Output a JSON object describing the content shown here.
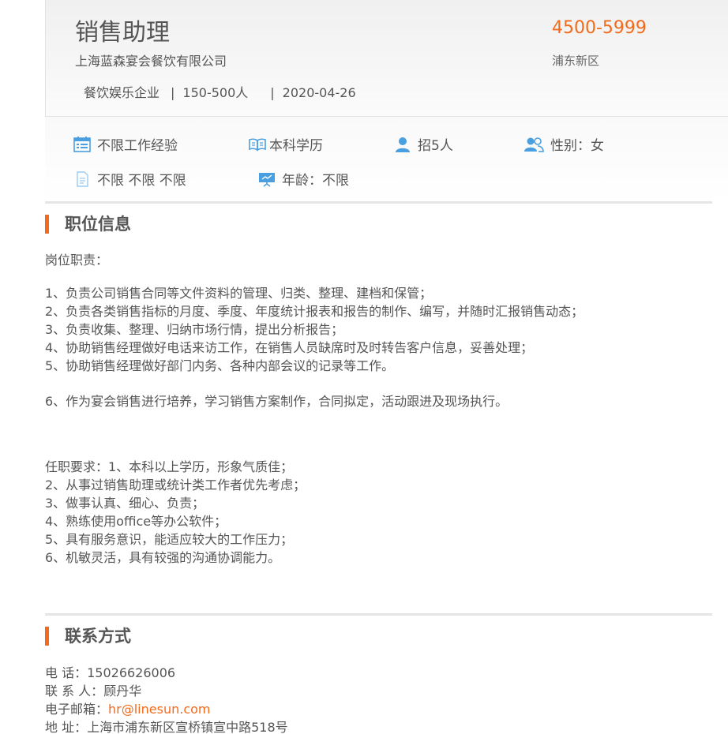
{
  "job": {
    "title": "销售助理",
    "company": "上海蓝森宴会餐饮有限公司",
    "industry": "餐饮娱乐企业",
    "size": "150-500人",
    "date": "2020-04-26",
    "separator": "|",
    "salary": "4500-5999",
    "location": "浦东新区"
  },
  "tags": {
    "experience": "不限工作经验",
    "education": "本科学历",
    "headcount": "招5人",
    "gender": "性别：女",
    "other": "不限 不限 不限",
    "age": "年龄：不限"
  },
  "position_info": {
    "title": "职位信息",
    "duties_label": "岗位职责：",
    "duties": [
      "1、负责公司销售合同等文件资料的管理、归类、整理、建档和保管；",
      "2、负责各类销售指标的月度、季度、年度统计报表和报告的制作、编写，并随时汇报销售动态；",
      "3、负责收集、整理、归纳市场行情，提出分析报告；",
      "4、协助销售经理做好电话来访工作，在销售人员缺席时及时转告客户信息，妥善处理；",
      "5、协助销售经理做好部门内务、各种内部会议的记录等工作。"
    ],
    "duty_6": "6、作为宴会销售进行培养，学习销售方案制作，合同拟定，活动跟进及现场执行。",
    "requirements": [
      "任职要求：1、本科以上学历，形象气质佳；",
      "2、从事过销售助理或统计类工作者优先考虑；",
      "3、做事认真、细心、负责；",
      "4、熟练使用office等办公软件；",
      "5、具有服务意识，能适应较大的工作压力；",
      "6、机敏灵活，具有较强的沟通协调能力。"
    ]
  },
  "contact": {
    "title": "联系方式",
    "phone_label": "电 话：",
    "phone": "15026626006",
    "person_label": "联 系 人：",
    "person": "顾丹华",
    "email_label": "电子邮箱：",
    "email": "hr@linesun.com",
    "address_label": "地 址：",
    "address": "上海市浦东新区宣桥镇宣中路518号"
  },
  "colors": {
    "accent": "#f26b1d",
    "icon_blue": "#4a9fe0",
    "text": "#555555"
  }
}
